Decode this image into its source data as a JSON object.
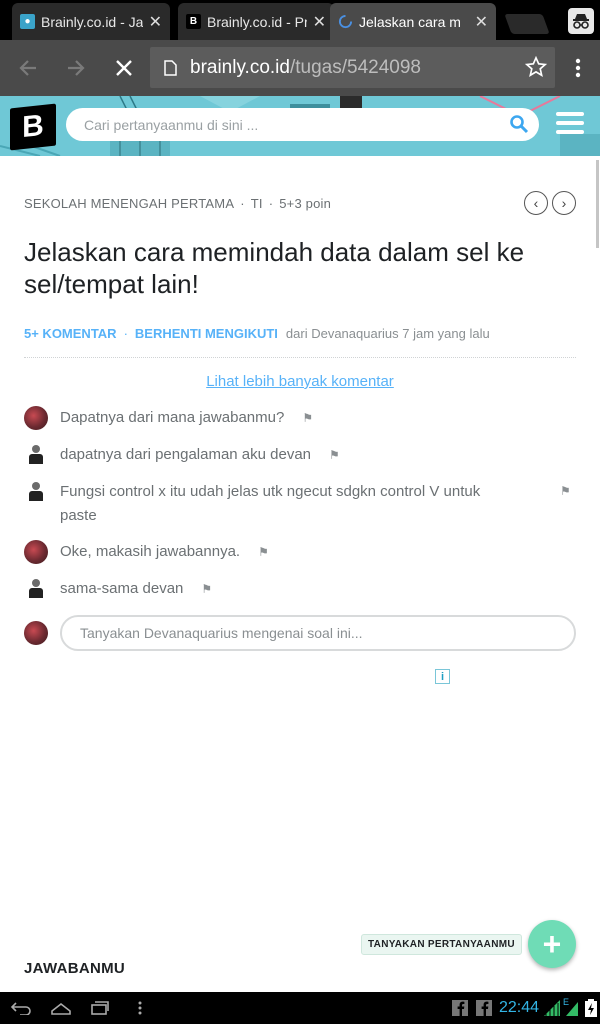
{
  "browser": {
    "tabs": [
      {
        "title": "Brainly.co.id - Ja",
        "active": false
      },
      {
        "title": "Brainly.co.id - Pr",
        "active": false
      },
      {
        "title": "Jelaskan cara m",
        "active": true,
        "loading": true
      }
    ],
    "url_domain": "brainly.co.id",
    "url_path": "/tugas/5424098",
    "icons": [
      "back-arrow-icon",
      "forward-arrow-icon",
      "stop-loading-icon",
      "page-icon",
      "star-icon",
      "menu-dots-icon",
      "incognito-icon"
    ]
  },
  "site": {
    "logo_letter": "B",
    "search_placeholder": "Cari pertanyaanmu di sini ...",
    "accent_color": "#57b2f8",
    "header_color": "#6fc8d6"
  },
  "question": {
    "level": "SEKOLAH MENENGAH PERTAMA",
    "subject": "TI",
    "points": "5+3 poin",
    "title": "Jelaskan cara memindah data dalam sel ke sel/tempat lain!",
    "comments_count": "5+ KOMENTAR",
    "unfollow": "BERHENTI MENGIKUTI",
    "author_line": "dari Devanaquarius 7 jam yang lalu"
  },
  "comments_section": {
    "more_link": "Lihat lebih banyak komentar",
    "items": [
      {
        "avatar": "red",
        "text": "Dapatnya dari mana jawabanmu?"
      },
      {
        "avatar": "person",
        "text": "dapatnya dari pengalaman aku devan"
      },
      {
        "avatar": "person",
        "text": "Fungsi control x itu udah jelas utk ngecut sdgkn control V untuk paste"
      },
      {
        "avatar": "red",
        "text": "Oke, makasih jawabannya."
      },
      {
        "avatar": "person",
        "text": "sama-sama devan"
      }
    ],
    "reply_placeholder": "Tanyakan Devanaquarius mengenai soal ini..."
  },
  "answers": {
    "title": "JAWABANMU",
    "ask_button_label": "TANYAKAN PERTANYAANMU"
  },
  "system": {
    "time": "22:44"
  }
}
